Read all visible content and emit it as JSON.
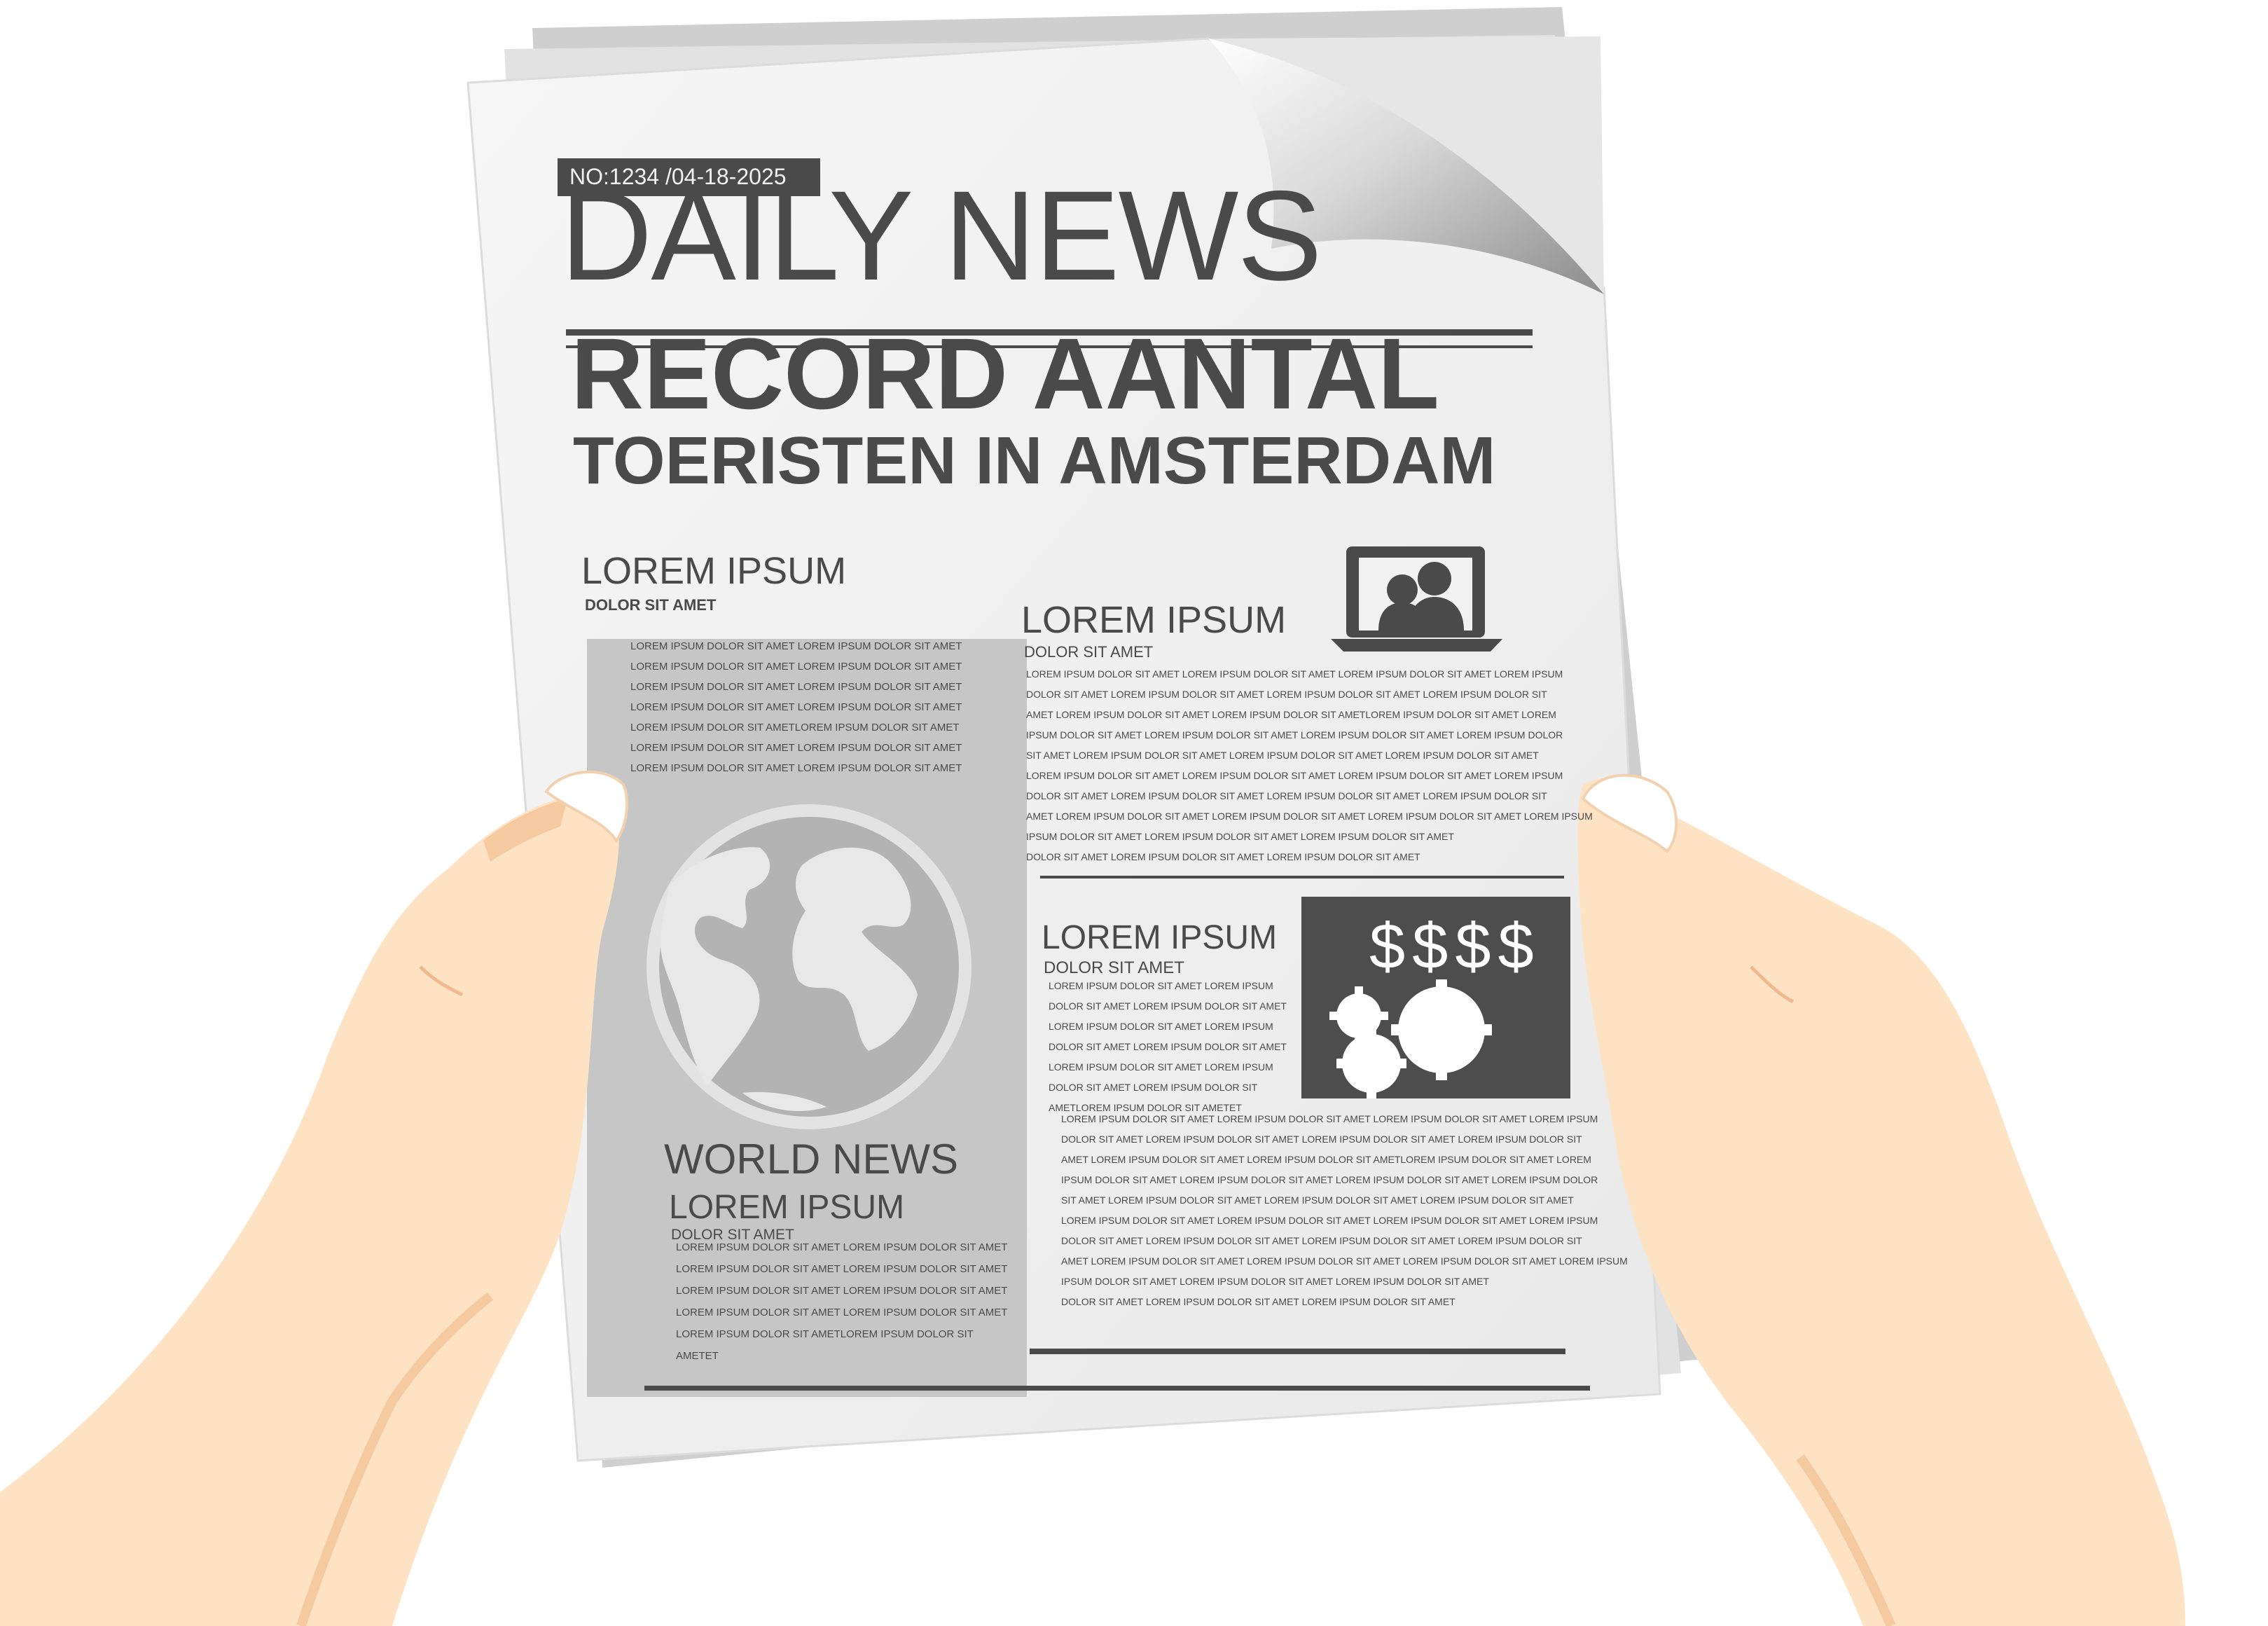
{
  "newspaper": {
    "issue_badge": "NO:1234 /04-18-2025",
    "masthead": "DAILY NEWS",
    "headline_line1": "RECORD AANTAL",
    "headline_line2": "TOERISTEN IN AMSTERDAM",
    "left_heading": "LOREM IPSUM",
    "left_subheading": "DOLOR SIT AMET",
    "left_body": [
      "LOREM IPSUM DOLOR SIT AMET LOREM IPSUM DOLOR SIT AMET",
      "LOREM IPSUM DOLOR SIT AMET LOREM IPSUM DOLOR SIT AMET",
      "LOREM IPSUM DOLOR SIT AMET LOREM IPSUM DOLOR SIT AMET",
      "LOREM IPSUM DOLOR SIT AMET LOREM IPSUM DOLOR SIT AMET",
      "LOREM IPSUM DOLOR SIT AMETLOREM IPSUM DOLOR SIT AMET",
      "LOREM IPSUM DOLOR SIT AMET LOREM IPSUM DOLOR SIT AMET",
      "LOREM IPSUM DOLOR SIT AMET LOREM IPSUM DOLOR SIT AMET"
    ],
    "world_heading": "WORLD NEWS",
    "world_subheading": "LOREM IPSUM",
    "world_subsub": "DOLOR SIT AMET",
    "world_body": [
      "LOREM IPSUM DOLOR SIT AMET LOREM IPSUM DOLOR SIT AMET",
      "LOREM IPSUM DOLOR SIT AMET LOREM IPSUM DOLOR SIT AMET",
      "LOREM IPSUM DOLOR SIT AMET LOREM IPSUM DOLOR SIT AMET",
      "LOREM IPSUM DOLOR SIT AMET LOREM IPSUM DOLOR SIT AMET",
      "LOREM  IPSUM  DOLOR  SIT  AMETLOREM  IPSUM  DOLOR  SIT",
      "AMETET"
    ],
    "right_heading": "LOREM IPSUM",
    "right_subheading": "DOLOR SIT AMET",
    "right_body": [
      "LOREM IPSUM DOLOR SIT AMET LOREM IPSUM DOLOR SIT AMET LOREM IPSUM DOLOR SIT AMET LOREM IPSUM",
      "DOLOR SIT AMET LOREM IPSUM DOLOR SIT AMET LOREM IPSUM DOLOR SIT AMET LOREM IPSUM DOLOR SIT",
      "AMET LOREM IPSUM DOLOR SIT AMET LOREM IPSUM DOLOR SIT AMETLOREM IPSUM DOLOR SIT AMET LOREM",
      "IPSUM DOLOR SIT AMET LOREM IPSUM DOLOR SIT AMET LOREM IPSUM DOLOR SIT AMET LOREM IPSUM DOLOR",
      "SIT AMET LOREM IPSUM DOLOR SIT AMET LOREM IPSUM DOLOR SIT AMET LOREM IPSUM DOLOR SIT AMET",
      "LOREM IPSUM DOLOR SIT AMET LOREM IPSUM DOLOR SIT AMET LOREM IPSUM DOLOR SIT AMET LOREM IPSUM",
      "DOLOR SIT AMET LOREM IPSUM DOLOR SIT AMET LOREM IPSUM DOLOR SIT AMET LOREM IPSUM DOLOR SIT",
      "AMET LOREM IPSUM DOLOR SIT AMET LOREM IPSUM DOLOR SIT AMET  LOREM  IPSUM  DOLOR SIT AMET  LOREM IPSUM",
      "IPSUM  DOLOR  SIT  AMET   LOREM  IPSUM  DOLOR  SIT AMET   LOREM  IPSUM  DOLOR  SIT  AMET",
      "DOLOR  SIT  AMET   LOREM IPSUM DOLOR SIT AMET   LOREM IPSUM DOLOR SIT AMET"
    ],
    "money_heading": "LOREM IPSUM",
    "money_subheading": "DOLOR SIT AMET",
    "money_symbols": "$$$$",
    "money_body": [
      "LOREM  IPSUM  DOLOR  SIT  AMET  LOREM  IPSUM",
      "DOLOR SIT AMET LOREM IPSUM DOLOR SIT AMET",
      "LOREM  IPSUM  DOLOR  SIT  AMET  LOREM  IPSUM",
      "DOLOR SIT AMET LOREM IPSUM DOLOR SIT AMET",
      "LOREM  IPSUM  DOLOR  SIT  AMET  LOREM  IPSUM",
      "DOLOR  SIT  AMET  LOREM  IPSUM  DOLOR  SIT",
      "AMETLOREM IPSUM DOLOR SIT AMETET"
    ],
    "bottom_body": [
      "LOREM IPSUM DOLOR SIT AMET LOREM IPSUM DOLOR SIT AMET LOREM IPSUM DOLOR SIT AMET LOREM IPSUM",
      "DOLOR SIT AMET LOREM IPSUM DOLOR SIT AMET LOREM IPSUM DOLOR SIT AMET LOREM IPSUM DOLOR SIT",
      "AMET LOREM IPSUM DOLOR SIT AMET LOREM IPSUM DOLOR SIT AMETLOREM IPSUM DOLOR SIT AMET LOREM",
      "IPSUM DOLOR SIT AMET LOREM IPSUM DOLOR SIT AMET LOREM IPSUM DOLOR SIT AMET LOREM IPSUM DOLOR",
      "SIT AMET LOREM IPSUM DOLOR SIT AMET LOREM IPSUM DOLOR SIT AMET LOREM IPSUM DOLOR SIT AMET",
      "LOREM IPSUM DOLOR SIT AMET LOREM IPSUM DOLOR SIT AMET LOREM IPSUM DOLOR SIT AMET LOREM IPSUM",
      "DOLOR SIT AMET LOREM IPSUM DOLOR SIT AMET LOREM IPSUM DOLOR SIT AMET LOREM IPSUM DOLOR SIT",
      "AMET LOREM IPSUM DOLOR SIT AMET LOREM IPSUM DOLOR SIT AMET  LOREM  IPSUM  DOLOR SIT AMET  LOREM IPSUM",
      "IPSUM  DOLOR  SIT  AMET   LOREM  IPSUM  DOLOR  SIT AMET   LOREM  IPSUM  DOLOR  SIT  AMET",
      "DOLOR  SIT  AMET   LOREM IPSUM DOLOR SIT AMET   LOREM IPSUM DOLOR SIT AMET"
    ]
  },
  "colors": {
    "paper": "#f1f1f1",
    "ink": "#4a4a4a",
    "panel": "#c6c6c6",
    "dark_box": "#4d4d4d",
    "skin": "#fde3c4",
    "skin_shadow": "#f6caa0"
  },
  "icons": [
    "globe-icon",
    "laptop-video-call-icon",
    "gears-icon",
    "page-curl"
  ]
}
